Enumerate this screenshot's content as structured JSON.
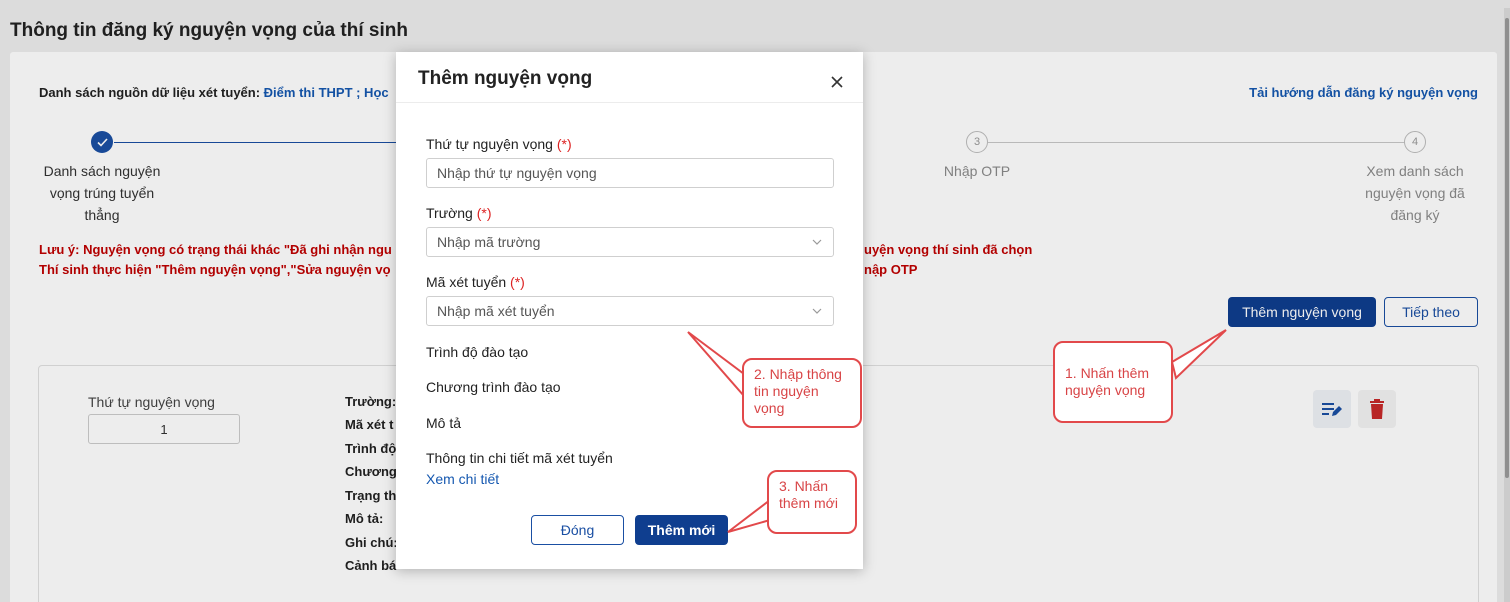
{
  "page": {
    "title": "Thông tin đăng ký nguyện vọng của thí sinh",
    "sources_prefix": "Danh sách nguồn dữ liệu xét tuyển:",
    "sources_values": "Điểm thi THPT ; Học",
    "guide_link": "Tải hướng dẫn đăng ký nguyện vọng"
  },
  "steps": [
    {
      "number": "✓",
      "label": "Danh sách nguyện vọng trúng tuyển thẳng",
      "state": "done"
    },
    {
      "number": "3",
      "label": "Nhập OTP",
      "state": "todo"
    },
    {
      "number": "4",
      "label": "Xem danh sách nguyện vọng đã đăng ký",
      "state": "todo"
    }
  ],
  "notes": {
    "line1_left": "Lưu ý: Nguyện vọng có trạng thái khác \"Đã ghi nhận ngu",
    "line1_right": "uyện vọng thí sinh đã chọn",
    "line2_left": "Thí sinh thực hiện \"Thêm nguyện vọng\",\"Sửa nguyện vọ",
    "line2_right": "nập OTP"
  },
  "actions": {
    "add_wish": "Thêm nguyện vọng",
    "next": "Tiếp theo"
  },
  "wish_item": {
    "order_label": "Thứ tự nguyện vọng",
    "order_value": "1",
    "fields": [
      "Trường:",
      "Mã xét t",
      "Trình độ",
      "Chương",
      "Trạng th",
      "Mô tả:",
      "Ghi chú:",
      "Cảnh bá"
    ]
  },
  "modal": {
    "title": "Thêm nguyện vọng",
    "order_label": "Thứ tự nguyện vọng",
    "order_placeholder": "Nhập thứ tự nguyện vọng",
    "school_label": "Trường",
    "school_placeholder": "Nhập mã trường",
    "code_label": "Mã xét tuyển",
    "code_placeholder": "Nhập mã xét tuyển",
    "required_mark": "(*)",
    "level_label": "Trình độ đào tạo",
    "program_label": "Chương trình đào tạo",
    "desc_label": "Mô tả",
    "detail_label": "Thông tin chi tiết mã xét tuyển",
    "detail_link": "Xem chi tiết",
    "close_button": "Đóng",
    "submit_button": "Thêm mới"
  },
  "callouts": {
    "c1": "1. Nhấn thêm nguyện vọng",
    "c2": "2. Nhập thông tin nguyện vọng",
    "c3": "3. Nhấn thêm mới"
  },
  "colors": {
    "primary": "#0f3e8f",
    "link": "#1558b0",
    "warning": "#c00000",
    "callout": "#e2494b",
    "delete": "#c62828"
  }
}
